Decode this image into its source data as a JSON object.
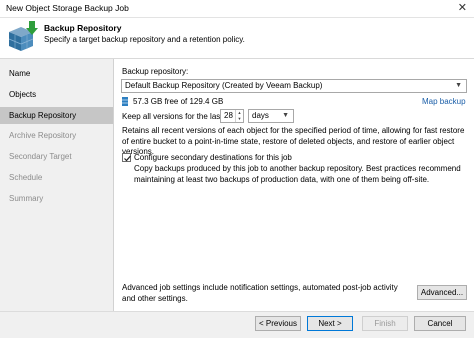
{
  "window": {
    "title": "New Object Storage Backup Job",
    "close_glyph": "✕"
  },
  "header": {
    "title": "Backup Repository",
    "subtitle": "Specify a target backup repository and a retention policy.",
    "icon": "database-arrow-icon"
  },
  "steps": [
    {
      "label": "Name",
      "state": "completed"
    },
    {
      "label": "Objects",
      "state": "completed"
    },
    {
      "label": "Backup Repository",
      "state": "active"
    },
    {
      "label": "Archive Repository",
      "state": "disabled"
    },
    {
      "label": "Secondary Target",
      "state": "disabled"
    },
    {
      "label": "Schedule",
      "state": "disabled"
    },
    {
      "label": "Summary",
      "state": "disabled"
    }
  ],
  "repository": {
    "label": "Backup repository:",
    "selected": "Default Backup Repository (Created by Veeam Backup)",
    "free_space": "57.3 GB free of 129.4 GB",
    "map_link": "Map backup"
  },
  "retention": {
    "label": "Keep all versions for the last:",
    "value": "28",
    "unit": "days",
    "description": "Retains all recent versions of each object for the specified period of time, allowing for fast restore of entire bucket to a point-in-time state, restore of deleted objects, and restore of earlier object versions."
  },
  "secondary": {
    "checkbox_label": "Configure secondary destinations for this job",
    "checked": true,
    "description": "Copy backups produced by this job to another backup repository. Best practices recommend maintaining at least two backups of production data, with one of them being off-site."
  },
  "advanced": {
    "text": "Advanced job settings include notification settings, automated post-job activity and other settings.",
    "button": "Advanced..."
  },
  "buttons": {
    "previous": "< Previous",
    "next": "Next >",
    "finish": "Finish",
    "cancel": "Cancel"
  },
  "colors": {
    "accent": "#0078d7",
    "link": "#1a5ea8",
    "active_step": "#c6c6c6"
  }
}
